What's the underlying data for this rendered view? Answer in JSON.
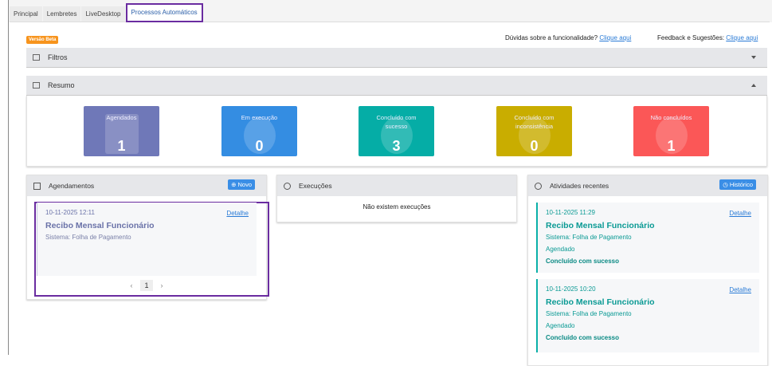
{
  "tabs": [
    "Principal",
    "Lembretes",
    "LiveDesktop",
    "Processos Automáticos"
  ],
  "badge": "Versão Beta",
  "help": {
    "q1": "Dúvidas sobre a funcionalidade?",
    "l1": "Clique aqui",
    "q2": "Feedback e Sugestões:",
    "l2": "Clique aqui"
  },
  "filtros": "Filtros",
  "resumo": "Resumo",
  "cards": [
    {
      "label": "Agendados",
      "value": "1",
      "color": "#6f78b8"
    },
    {
      "label": "Em execução",
      "value": "0",
      "color": "#348de2"
    },
    {
      "label": "Concluído com sucesso",
      "value": "3",
      "color": "#05ada6"
    },
    {
      "label": "Concluído com inconsistência",
      "value": "0",
      "color": "#c9ad00"
    },
    {
      "label": "Não concluídos",
      "value": "1",
      "color": "#fb5757"
    }
  ],
  "agendamentos": {
    "title": "Agendamentos",
    "button": "⊕ Novo",
    "item": {
      "date": "10-11-2025 12:11",
      "detail": "Detalhe",
      "title": "Recibo Mensal Funcionário",
      "system": "Sistema: Folha de Pagamento"
    },
    "page": "1"
  },
  "execucoes": {
    "title": "Execuções",
    "empty": "Não existem execuções"
  },
  "atividades": {
    "title": "Atividades recentes",
    "button": "◷ Histórico",
    "items": [
      {
        "date": "10-11-2025 11:29",
        "detail": "Detalhe",
        "title": "Recibo Mensal Funcionário",
        "system": "Sistema: Folha de Pagamento",
        "type": "Agendado",
        "status": "Concluído com sucesso"
      },
      {
        "date": "10-11-2025 10:20",
        "detail": "Detalhe",
        "title": "Recibo Mensal Funcionário",
        "system": "Sistema: Folha de Pagamento",
        "type": "Agendado",
        "status": "Concluído com sucesso"
      }
    ]
  }
}
